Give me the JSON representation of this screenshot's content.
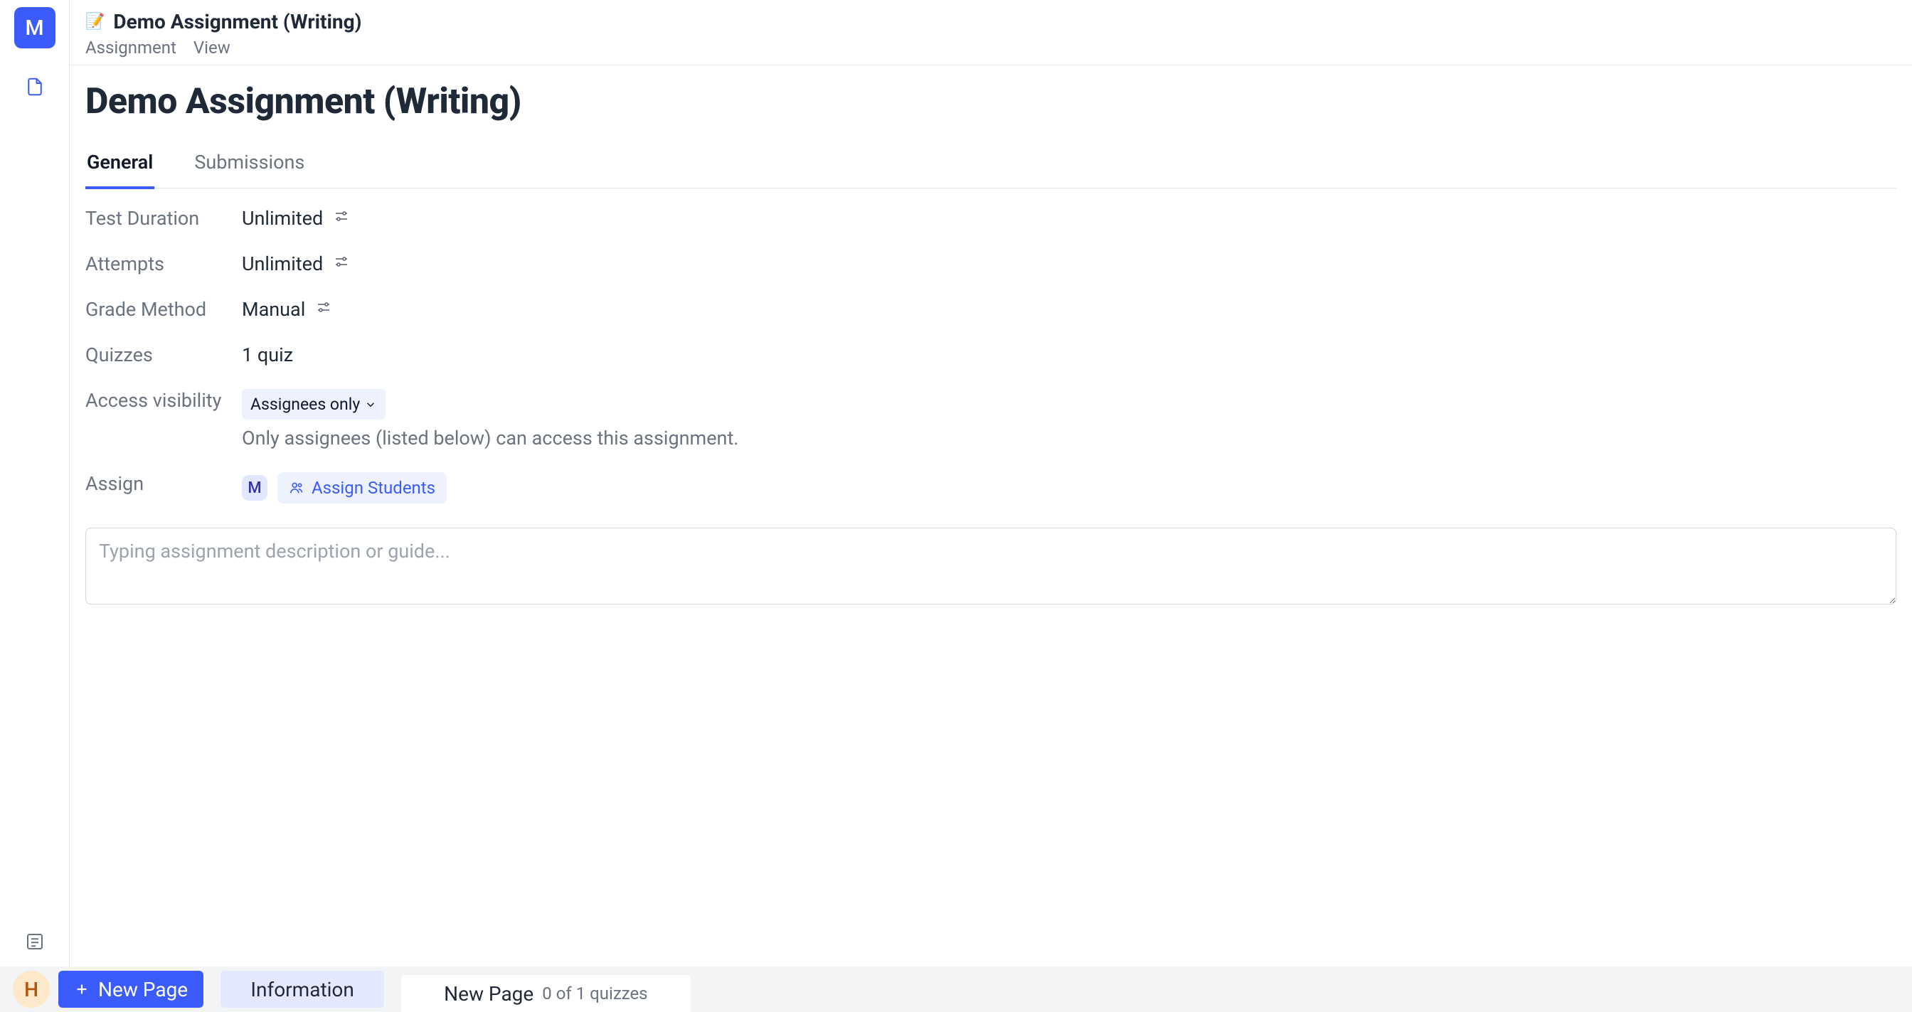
{
  "rail": {
    "avatar_initial": "M"
  },
  "header": {
    "emoji": "📝",
    "title": "Demo Assignment (Writing)",
    "menu": [
      "Assignment",
      "View"
    ]
  },
  "page": {
    "title": "Demo Assignment (Writing)",
    "tabs": [
      {
        "label": "General",
        "active": true
      },
      {
        "label": "Submissions",
        "active": false
      }
    ]
  },
  "meta": {
    "test_duration": {
      "label": "Test Duration",
      "value": "Unlimited"
    },
    "attempts": {
      "label": "Attempts",
      "value": "Unlimited"
    },
    "grade_method": {
      "label": "Grade Method",
      "value": "Manual"
    },
    "quizzes": {
      "label": "Quizzes",
      "value": "1 quiz"
    },
    "access": {
      "label": "Access visibility",
      "value": "Assignees only",
      "hint": "Only assignees (listed below) can access this assignment."
    },
    "assign": {
      "label": "Assign",
      "assignees": [
        "M"
      ],
      "button": "Assign Students"
    }
  },
  "description_placeholder": "Typing assignment description or guide...",
  "bottombar": {
    "avatar_initial": "H",
    "new_page": "New Page",
    "information": "Information",
    "tab_title": "New Page",
    "tab_sub": "0 of 1 quizzes"
  }
}
